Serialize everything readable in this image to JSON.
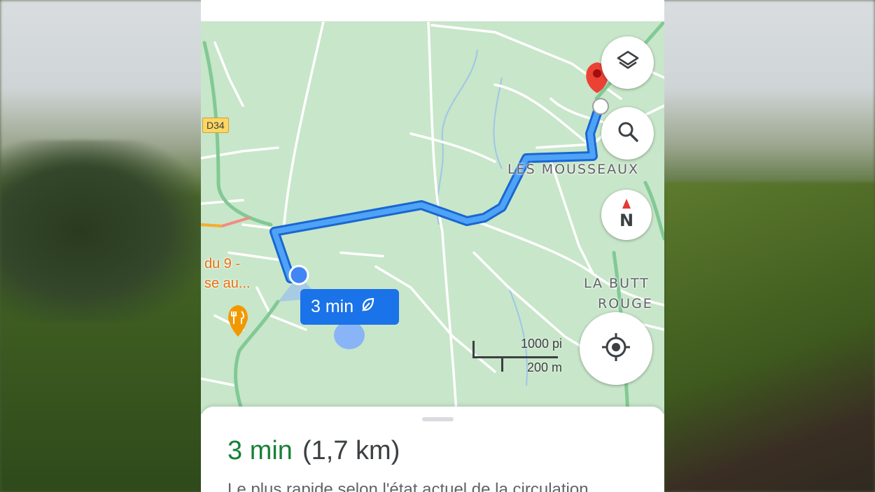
{
  "map": {
    "road_shield": "D34",
    "place_labels": [
      "LES MOUSSEAUX",
      "LA BUTT",
      "ROUGE"
    ],
    "poi_label_line1": "du 9 -",
    "poi_label_line2": "se au...",
    "poi_icon": "restaurant-icon",
    "scale_imperial": "1000 pi",
    "scale_metric": "200 m",
    "eta_bubble_text": "3 min",
    "eta_icon": "leaf-icon",
    "route_color": "#1a73e8",
    "map_background": "#c8e6c9"
  },
  "controls": {
    "layers_icon": "layers-icon",
    "search_icon": "search-icon",
    "compass_letter": "N",
    "location_icon": "my-location-icon"
  },
  "sheet": {
    "duration": "3 min",
    "distance": "(1,7 km)",
    "subtitle": "Le plus rapide selon l'état actuel de la circulation"
  }
}
